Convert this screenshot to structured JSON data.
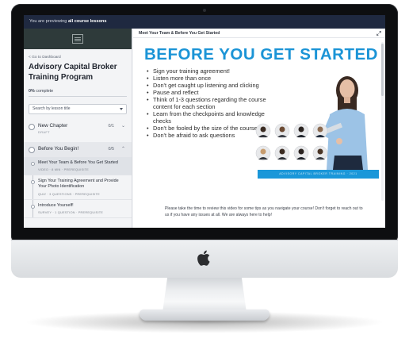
{
  "preview_bar": {
    "prefix": "You are previewing",
    "emphasis": "all course lessons"
  },
  "sidebar": {
    "back_link": "< Go to Dashboard",
    "course_title": "Advisory Capital Broker Training Program",
    "progress": {
      "percent_label": "0%",
      "suffix": " complete",
      "value": 0
    },
    "search_placeholder": "Search by lesson title",
    "chapters": [
      {
        "title": "New Chapter",
        "subtitle": "DRAFT",
        "count": "0/1",
        "chevron": "⌄"
      },
      {
        "title": "Before You Begin!",
        "count": "0/5",
        "chevron": "⌃"
      }
    ],
    "lessons": [
      {
        "title": "Meet Your Team & Before You Get Started",
        "meta": "VIDEO · 8 MIN · PREREQUISITE"
      },
      {
        "title": "Sign Your Training Agreement and Provide Your Photo Identification",
        "meta": "QUIZ · 3 QUESTIONS · PREREQUISITE"
      },
      {
        "title": "Introduce Yourself!",
        "meta": "SURVEY · 1 QUESTION · PREREQUISITE"
      }
    ]
  },
  "main": {
    "lesson_title": "Meet Your Team & Before You Get Started",
    "slide": {
      "title": "BEFORE YOU GET STARTED",
      "bullets": [
        "Sign your training agreement!",
        "Listen more than once",
        "Don't get caught up listening and clicking",
        "Pause and reflect",
        "Think of 1-3 questions regarding the course content for each section",
        "Learn from the checkpoints and knowledge checks",
        "Don't be fooled by the size of the course",
        "Don't be afraid to ask questions"
      ],
      "banner": "ADVISORY CAPITAL BROKER TRAINING · 2021"
    },
    "description": "Please take the time to review this video for some tips as you navigate your course! Don't forget to reach out to us if you have any issues at all. We are always here to help!"
  },
  "colors": {
    "accent": "#1b94d6",
    "preview_bar": "#1f2940",
    "sidebar_header": "#2e3a3a"
  }
}
